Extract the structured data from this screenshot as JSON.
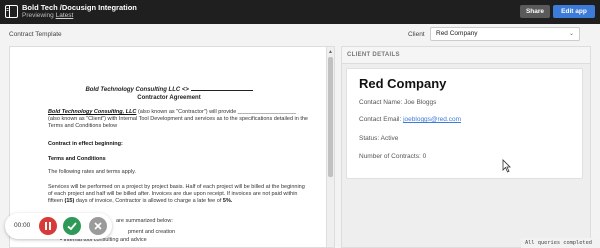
{
  "header": {
    "app_title": "Bold Tech /Docusign Integration",
    "preview_text": "Previewing",
    "preview_link": "Latest",
    "share_label": "Share",
    "edit_label": "Edit app"
  },
  "contract_label": "Contract Template",
  "client_select": {
    "label": "Client",
    "value": "Red Company"
  },
  "document": {
    "title_prefix": "Bold Technology Consulting LLC <>",
    "subtitle": "Contractor Agreement",
    "intro_company": "Bold Technology Consulting, LLC",
    "intro_rest": "(also known as \"Contractor\") will provide ___________________ (also known as \"Client\") with Internal Tool Development and services as to the specifications detailed in the Terms and Conditions below",
    "contract_effect": "Contract in effect beginning:",
    "terms_heading": "Terms and Conditions",
    "terms_line": "The following rates and terms apply.",
    "services_para_a": "Services will be performed on a project by project basis. Half of each project will be billed at the beginning of each project and half will be billed after. Invoices are due upon receipt. If invoices are not paid within fifteen",
    "services_fifteen": "(15)",
    "services_para_b": "days of invoice, Contractor is allowed to charge a late fee of",
    "late_fee": "5%.",
    "summarized": "are summarized below:",
    "bullet_a": "pment and creation",
    "bullet_b": "Internal tool consulting and advice"
  },
  "client_details": {
    "heading": "CLIENT DETAILS",
    "name": "Red Company",
    "contact_name": "Contact Name: Joe Bloggs",
    "contact_email_label": "Contact Email:",
    "contact_email": "joebloggs@red.com",
    "status": "Status: Active",
    "contracts": "Number of Contracts: 0"
  },
  "recorder": {
    "time": "00:00"
  },
  "status_bar": "All queries completed",
  "colors": {
    "header_bg": "#1f1f1f",
    "accent": "#3d7bd8",
    "stop": "#d83a3a",
    "done": "#2e9a57"
  }
}
